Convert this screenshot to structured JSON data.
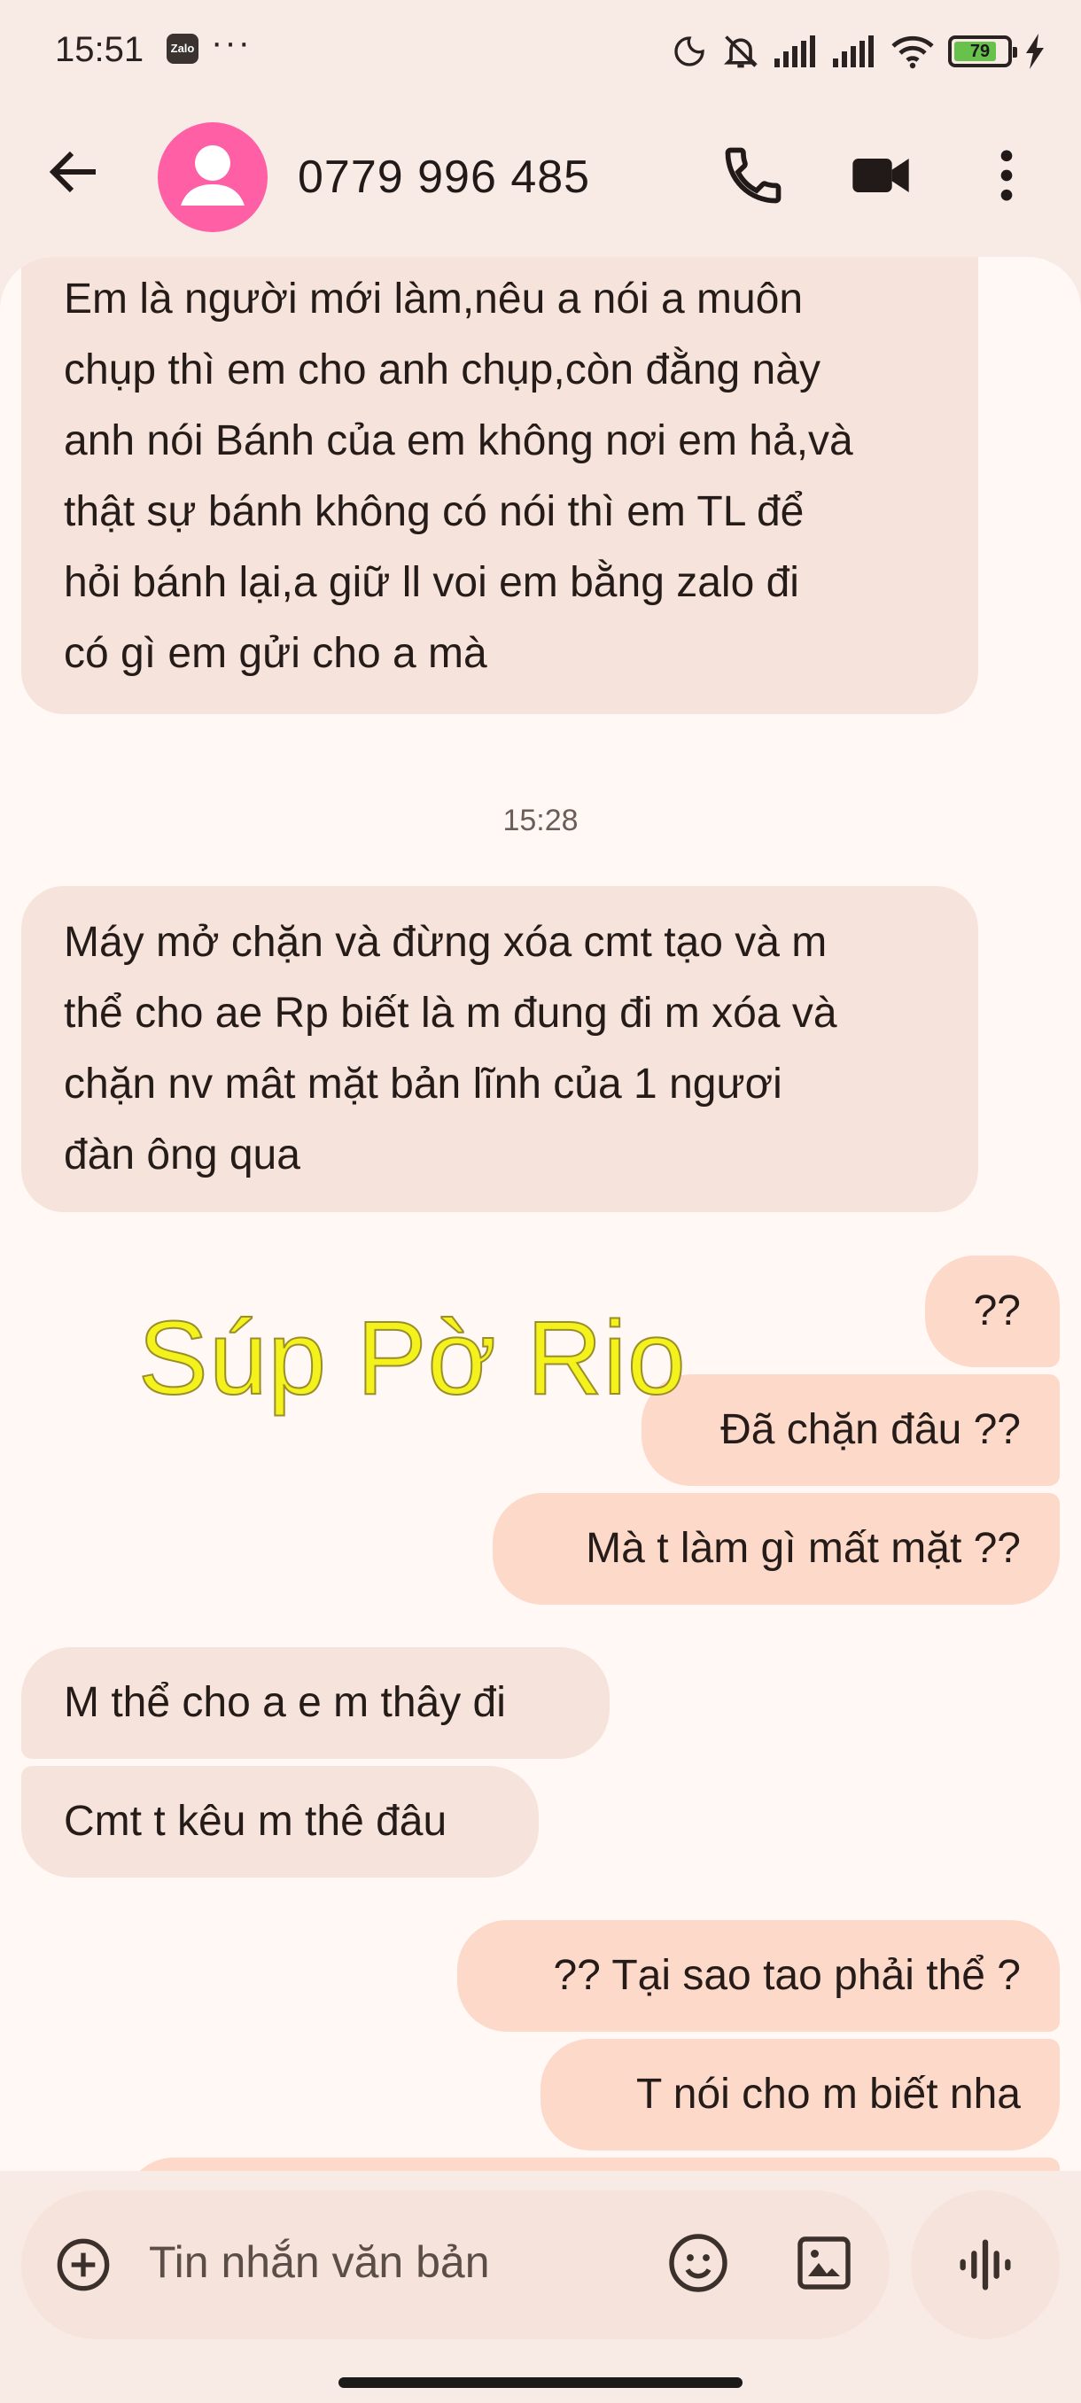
{
  "status_bar": {
    "time": "15:51",
    "zalo_label": "Zalo",
    "overflow": "···",
    "battery_level": "79",
    "icons": [
      "moon-icon",
      "silent-icon",
      "signal-icon",
      "signal-icon",
      "wifi-icon",
      "battery-icon",
      "charging-icon"
    ]
  },
  "header": {
    "contact": "0779 996 485",
    "icons": [
      "back-arrow-icon",
      "avatar-person-icon",
      "phone-icon",
      "video-icon",
      "more-vert-icon"
    ]
  },
  "conversation": {
    "timestamp": "15:28",
    "watermark": "Súp Pờ Rio",
    "messages": [
      {
        "dir": "in",
        "lines": [
          "Em là người mới làm,nêu a nói a muôn",
          "chụp thì em cho anh chụp,còn đằng này",
          "anh nói Bánh của em không nơi em hả,và",
          "thật sự bánh không có nói thì em TL để",
          "hỏi bánh lại,a giữ ll voi em bằng zalo đi",
          "có gì em gửi cho a mà"
        ]
      },
      {
        "dir": "in",
        "lines": [
          "Máy mở chặn và đừng xóa cmt tạo và m",
          "thể cho ae Rp biết là m đung đi m xóa và",
          "chặn nv mât mặt bản lĩnh của 1 ngươi",
          "đàn ông qua"
        ]
      },
      {
        "dir": "out",
        "lines": [
          "??"
        ]
      },
      {
        "dir": "out",
        "lines": [
          "Đã chặn đâu ??"
        ]
      },
      {
        "dir": "out",
        "lines": [
          "Mà t làm gì mất mặt ??"
        ]
      },
      {
        "dir": "in",
        "lines": [
          "M thể cho a e m thây đi"
        ]
      },
      {
        "dir": "in",
        "lines": [
          "Cmt t kêu m thê đâu"
        ]
      },
      {
        "dir": "out",
        "lines": [
          "?? Tại sao tao phải thể ?"
        ]
      },
      {
        "dir": "out",
        "lines": [
          "T nói cho m biết nha"
        ]
      }
    ]
  },
  "composer": {
    "placeholder": "Tin nhắn văn bản",
    "icons": [
      "add-circle-icon",
      "emoji-icon",
      "gallery-icon",
      "voice-icon"
    ]
  },
  "colors": {
    "background": "#f8ebe6",
    "incoming_bubble": "#f6e4dc",
    "outgoing_bubble": "#fdd9c9",
    "avatar": "#ff5fa5",
    "watermark": "#f4f21c"
  }
}
